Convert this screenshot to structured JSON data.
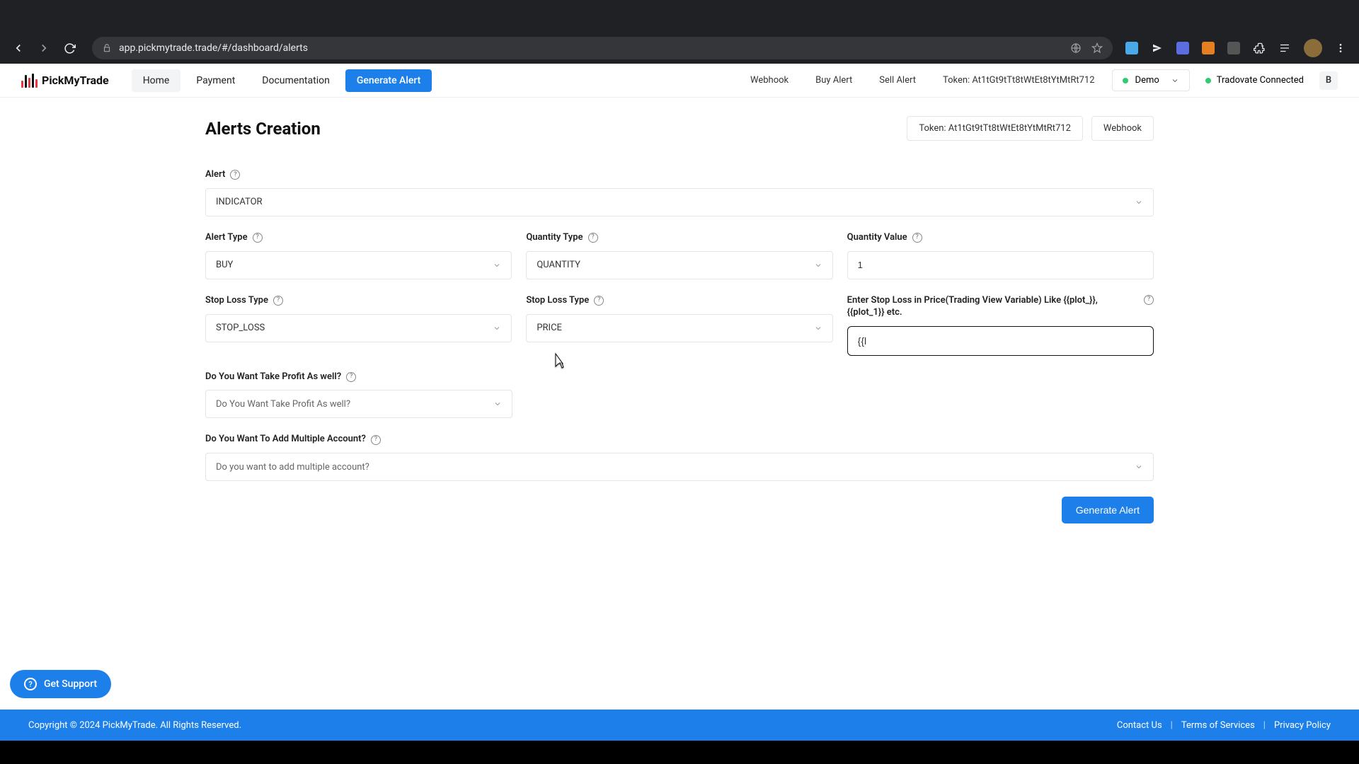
{
  "browser": {
    "url": "app.pickmytrade.trade/#/dashboard/alerts"
  },
  "brand": "PickMyTrade",
  "nav": {
    "home": "Home",
    "payment": "Payment",
    "documentation": "Documentation",
    "generate_alert": "Generate Alert"
  },
  "right_nav": {
    "webhook": "Webhook",
    "buy_alert": "Buy Alert",
    "sell_alert": "Sell Alert",
    "token_label": "Token: At1tGt9tTt8tWtEt8tYtMtRt712",
    "mode": "Demo",
    "connection": "Tradovate Connected",
    "user_initial": "B"
  },
  "page": {
    "title": "Alerts Creation",
    "token_box": "Token: At1tGt9tTt8tWtEt8tYtMtRt712",
    "webhook_box": "Webhook"
  },
  "form": {
    "alert_label": "Alert",
    "alert_value": "INDICATOR",
    "alert_type_label": "Alert Type",
    "alert_type_value": "BUY",
    "qty_type_label": "Quantity Type",
    "qty_type_value": "QUANTITY",
    "qty_value_label": "Quantity Value",
    "qty_value": "1",
    "sl_type_label": "Stop Loss Type",
    "sl_type_value": "STOP_LOSS",
    "sl_type2_label": "Stop Loss Type",
    "sl_type2_value": "PRICE",
    "sl_price_label": "Enter Stop Loss in Price(Trading View Variable) Like {{plot_}}, {{plot_1}} etc.",
    "sl_price_value": "{{l",
    "tp_label": "Do You Want Take Profit As well?",
    "tp_value": "Do You Want Take Profit As well?",
    "multi_label": "Do You Want To Add Multiple Account?",
    "multi_value": "Do you want to add multiple account?",
    "submit": "Generate Alert"
  },
  "support": "Get Support",
  "footer": {
    "copyright": "Copyright © 2024 PickMyTrade. All Rights Reserved.",
    "contact": "Contact Us",
    "terms": "Terms of Services",
    "privacy": "Privacy Policy"
  }
}
